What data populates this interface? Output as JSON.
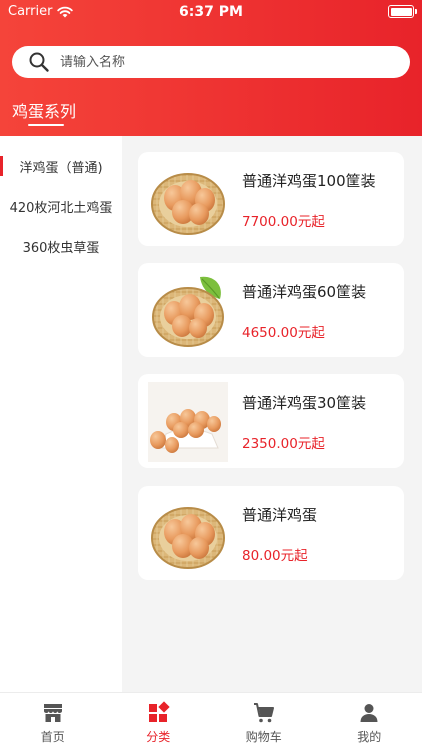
{
  "status": {
    "carrier": "Carrier",
    "time": "6:37 PM"
  },
  "search": {
    "placeholder": "请输入名称"
  },
  "series_title": "鸡蛋系列",
  "categories": [
    {
      "label": "洋鸡蛋（普通)"
    },
    {
      "label": "420枚河北土鸡蛋"
    },
    {
      "label": "360枚虫草蛋"
    }
  ],
  "products": [
    {
      "name": "普通洋鸡蛋100筐装",
      "price": "7700.00元起",
      "image": "egg-basket-icon"
    },
    {
      "name": "普通洋鸡蛋60筐装",
      "price": "4650.00元起",
      "image": "egg-basket-leaf-icon"
    },
    {
      "name": "普通洋鸡蛋30筐装",
      "price": "2350.00元起",
      "image": "egg-plate-icon"
    },
    {
      "name": "普通洋鸡蛋",
      "price": "80.00元起",
      "image": "egg-basket-icon"
    }
  ],
  "tabs": [
    {
      "label": "首页",
      "icon": "store-icon"
    },
    {
      "label": "分类",
      "icon": "category-icon"
    },
    {
      "label": "购物车",
      "icon": "cart-icon"
    },
    {
      "label": "我的",
      "icon": "person-icon"
    }
  ],
  "colors": {
    "accent": "#e8232a",
    "header_start": "#f5443a",
    "content_bg": "#f4f4f4"
  }
}
